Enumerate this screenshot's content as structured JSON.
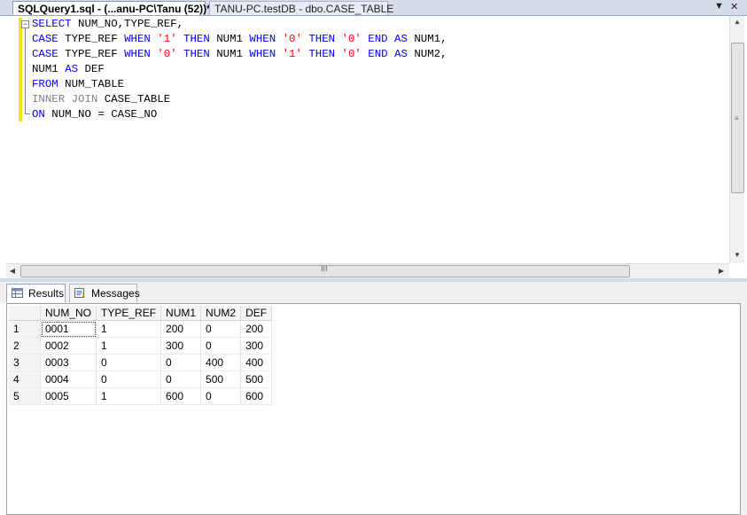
{
  "tabs": {
    "active_label": "SQLQuery1.sql - (...anu-PC\\Tanu (52))*",
    "inactive_label": "TANU-PC.testDB - dbo.CASE_TABLE",
    "dropdown_glyph": "▼",
    "close_glyph": "✕"
  },
  "editor": {
    "lines": [
      [
        {
          "t": "SELECT",
          "c": "kw"
        },
        {
          "t": " NUM_NO,TYPE_REF,",
          "c": "plain"
        }
      ],
      [
        {
          "t": "CASE",
          "c": "kw"
        },
        {
          "t": " TYPE_REF ",
          "c": "plain"
        },
        {
          "t": "WHEN",
          "c": "kw"
        },
        {
          "t": " ",
          "c": "plain"
        },
        {
          "t": "'1'",
          "c": "str"
        },
        {
          "t": " ",
          "c": "plain"
        },
        {
          "t": "THEN",
          "c": "kw"
        },
        {
          "t": " NUM1 ",
          "c": "plain"
        },
        {
          "t": "WHEN",
          "c": "kw"
        },
        {
          "t": " ",
          "c": "plain"
        },
        {
          "t": "'0'",
          "c": "str"
        },
        {
          "t": " ",
          "c": "plain"
        },
        {
          "t": "THEN",
          "c": "kw"
        },
        {
          "t": " ",
          "c": "plain"
        },
        {
          "t": "'0'",
          "c": "str"
        },
        {
          "t": " ",
          "c": "plain"
        },
        {
          "t": "END",
          "c": "kw"
        },
        {
          "t": " ",
          "c": "plain"
        },
        {
          "t": "AS",
          "c": "kw"
        },
        {
          "t": " NUM1,",
          "c": "plain"
        }
      ],
      [
        {
          "t": "CASE",
          "c": "kw"
        },
        {
          "t": " TYPE_REF ",
          "c": "plain"
        },
        {
          "t": "WHEN",
          "c": "kw"
        },
        {
          "t": " ",
          "c": "plain"
        },
        {
          "t": "'0'",
          "c": "str"
        },
        {
          "t": " ",
          "c": "plain"
        },
        {
          "t": "THEN",
          "c": "kw"
        },
        {
          "t": " NUM1 ",
          "c": "plain"
        },
        {
          "t": "WHEN",
          "c": "kw"
        },
        {
          "t": " ",
          "c": "plain"
        },
        {
          "t": "'1'",
          "c": "str"
        },
        {
          "t": " ",
          "c": "plain"
        },
        {
          "t": "THEN",
          "c": "kw"
        },
        {
          "t": " ",
          "c": "plain"
        },
        {
          "t": "'0'",
          "c": "str"
        },
        {
          "t": " ",
          "c": "plain"
        },
        {
          "t": "END",
          "c": "kw"
        },
        {
          "t": " ",
          "c": "plain"
        },
        {
          "t": "AS",
          "c": "kw"
        },
        {
          "t": " NUM2,",
          "c": "plain"
        }
      ],
      [
        {
          "t": "NUM1 ",
          "c": "plain"
        },
        {
          "t": "AS",
          "c": "kw"
        },
        {
          "t": " DEF",
          "c": "plain"
        }
      ],
      [
        {
          "t": "FROM",
          "c": "kw"
        },
        {
          "t": " NUM_TABLE",
          "c": "plain"
        }
      ],
      [
        {
          "t": "INNER JOIN",
          "c": "gray"
        },
        {
          "t": " CASE_TABLE",
          "c": "plain"
        }
      ],
      [
        {
          "t": "ON",
          "c": "kw"
        },
        {
          "t": " NUM_NO = CASE_NO",
          "c": "plain"
        }
      ]
    ],
    "collapse_glyph": "−"
  },
  "scroll": {
    "up": "▲",
    "down": "▼",
    "left": "◀",
    "right": "▶",
    "grip_v": "≡",
    "grip_h": "III"
  },
  "results_tabs": {
    "results_label": "Results",
    "messages_label": "Messages"
  },
  "grid": {
    "columns": [
      "NUM_NO",
      "TYPE_REF",
      "NUM1",
      "NUM2",
      "DEF"
    ],
    "rows": [
      {
        "n": "1",
        "cells": [
          "0001",
          "1",
          "200",
          "0",
          "200"
        ]
      },
      {
        "n": "2",
        "cells": [
          "0002",
          "1",
          "300",
          "0",
          "300"
        ]
      },
      {
        "n": "3",
        "cells": [
          "0003",
          "0",
          "0",
          "400",
          "400"
        ]
      },
      {
        "n": "4",
        "cells": [
          "0004",
          "0",
          "0",
          "500",
          "500"
        ]
      },
      {
        "n": "5",
        "cells": [
          "0005",
          "1",
          "600",
          "0",
          "600"
        ]
      }
    ]
  }
}
